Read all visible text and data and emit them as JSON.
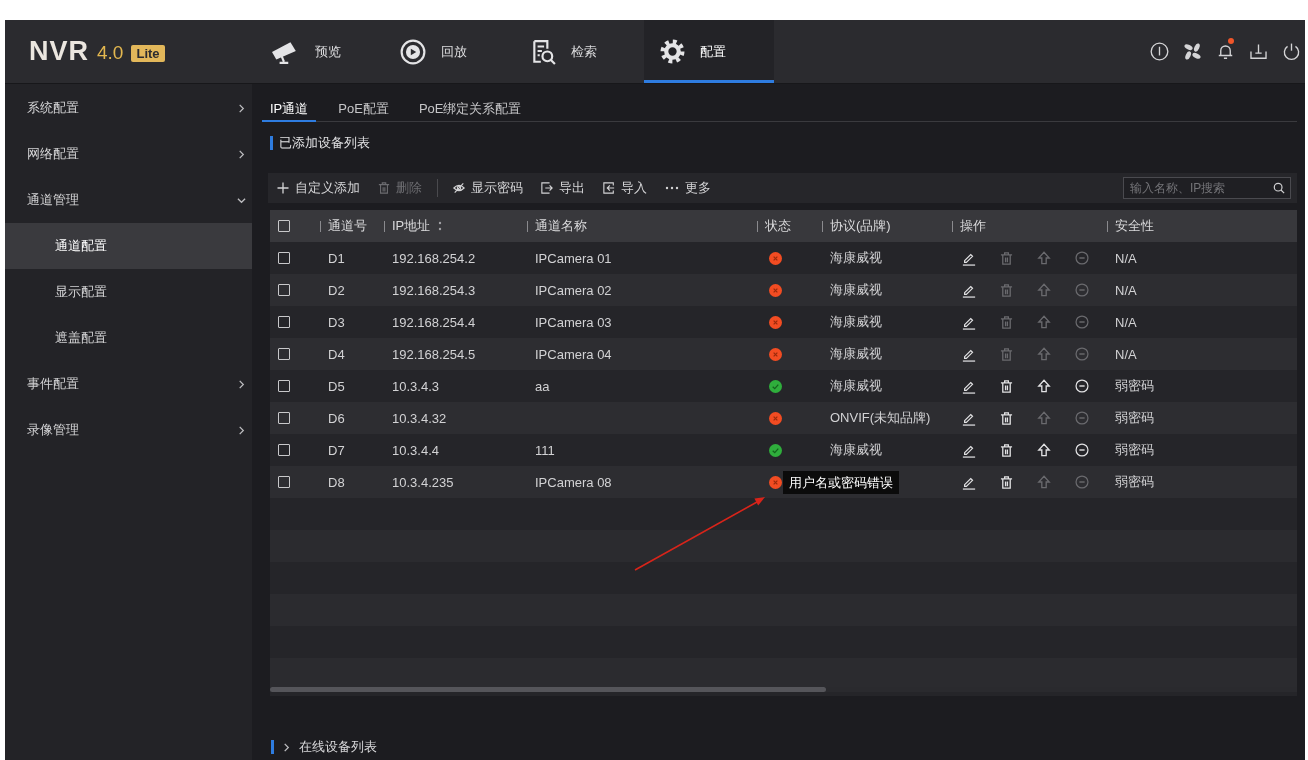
{
  "header": {
    "logo": {
      "name": "NVR",
      "version": "4.0",
      "edition": "Lite"
    },
    "nav": [
      {
        "label": "预览",
        "selected": false
      },
      {
        "label": "回放",
        "selected": false
      },
      {
        "label": "检索",
        "selected": false
      },
      {
        "label": "配置",
        "selected": true
      }
    ],
    "alert": true
  },
  "sidebar": {
    "items": [
      {
        "label": "系统配置",
        "expanded": false,
        "selected": false
      },
      {
        "label": "网络配置",
        "expanded": false,
        "selected": false
      },
      {
        "label": "通道管理",
        "expanded": true,
        "selected": false,
        "children": [
          {
            "label": "通道配置",
            "selected": true
          },
          {
            "label": "显示配置",
            "selected": false
          },
          {
            "label": "遮盖配置",
            "selected": false
          }
        ]
      },
      {
        "label": "事件配置",
        "expanded": false,
        "selected": false
      },
      {
        "label": "录像管理",
        "expanded": false,
        "selected": false
      }
    ]
  },
  "tabs": [
    {
      "label": "IP通道",
      "selected": true
    },
    {
      "label": "PoE配置",
      "selected": false
    },
    {
      "label": "PoE绑定关系配置",
      "selected": false
    }
  ],
  "device_list": {
    "title": "已添加设备列表",
    "toolbar": {
      "buttons": [
        {
          "label": "自定义添加",
          "disabled": false
        },
        {
          "label": "删除",
          "disabled": true
        },
        {
          "label": "显示密码",
          "disabled": false
        },
        {
          "label": "导出",
          "disabled": false
        },
        {
          "label": "导入",
          "disabled": false
        },
        {
          "label": "更多",
          "disabled": false
        }
      ],
      "search": {
        "placeholder": "输入名称、IP搜索"
      }
    },
    "table": {
      "header_checked": false,
      "columns": [
        {
          "label": "通道号"
        },
        {
          "label": "IP地址",
          "sortable": true
        },
        {
          "label": "通道名称"
        },
        {
          "label": "状态"
        },
        {
          "label": "协议(品牌)"
        },
        {
          "label": "操作"
        },
        {
          "label": "安全性"
        }
      ],
      "rows": [
        {
          "checked": false,
          "channel": "D1",
          "ip": "192.168.254.2",
          "name": "IPCamera 01",
          "online": false,
          "protocol": "海康威视",
          "actions": [
            {
              "disabled": false
            },
            {
              "disabled": true
            },
            {
              "disabled": true
            },
            {
              "disabled": true
            }
          ],
          "security": "N/A"
        },
        {
          "checked": false,
          "channel": "D2",
          "ip": "192.168.254.3",
          "name": "IPCamera 02",
          "online": false,
          "protocol": "海康威视",
          "actions": [
            {
              "disabled": false
            },
            {
              "disabled": true
            },
            {
              "disabled": true
            },
            {
              "disabled": true
            }
          ],
          "security": "N/A"
        },
        {
          "checked": false,
          "channel": "D3",
          "ip": "192.168.254.4",
          "name": "IPCamera 03",
          "online": false,
          "protocol": "海康威视",
          "actions": [
            {
              "disabled": false
            },
            {
              "disabled": true
            },
            {
              "disabled": true
            },
            {
              "disabled": true
            }
          ],
          "security": "N/A"
        },
        {
          "checked": false,
          "channel": "D4",
          "ip": "192.168.254.5",
          "name": "IPCamera 04",
          "online": false,
          "protocol": "海康威视",
          "actions": [
            {
              "disabled": false
            },
            {
              "disabled": true
            },
            {
              "disabled": true
            },
            {
              "disabled": true
            }
          ],
          "security": "N/A"
        },
        {
          "checked": false,
          "channel": "D5",
          "ip": "10.3.4.3",
          "name": "aa",
          "online": true,
          "protocol": "海康威视",
          "actions": [
            {
              "disabled": false
            },
            {
              "disabled": false
            },
            {
              "disabled": false
            },
            {
              "disabled": false
            }
          ],
          "security": "弱密码"
        },
        {
          "checked": false,
          "channel": "D6",
          "ip": "10.3.4.32",
          "online": false,
          "protocol": "ONVIF(未知品牌)",
          "actions": [
            {
              "disabled": false
            },
            {
              "disabled": false
            },
            {
              "disabled": true
            },
            {
              "disabled": true
            }
          ],
          "security": "弱密码"
        },
        {
          "checked": false,
          "channel": "D7",
          "ip": "10.3.4.4",
          "name": "111",
          "online": true,
          "protocol": "海康威视",
          "actions": [
            {
              "disabled": false
            },
            {
              "disabled": false
            },
            {
              "disabled": false
            },
            {
              "disabled": false
            }
          ],
          "security": "弱密码"
        },
        {
          "checked": false,
          "channel": "D8",
          "ip": "10.3.4.235",
          "name": "IPCamera 08",
          "online": false,
          "tooltip": "用户名或密码错误",
          "actions": [
            {
              "disabled": false
            },
            {
              "disabled": false
            },
            {
              "disabled": true
            },
            {
              "disabled": true
            }
          ],
          "security": "弱密码"
        }
      ]
    }
  },
  "annotation": {
    "kind": "arrow"
  },
  "online_list": {
    "title": "在线设备列表",
    "expanded": false
  }
}
